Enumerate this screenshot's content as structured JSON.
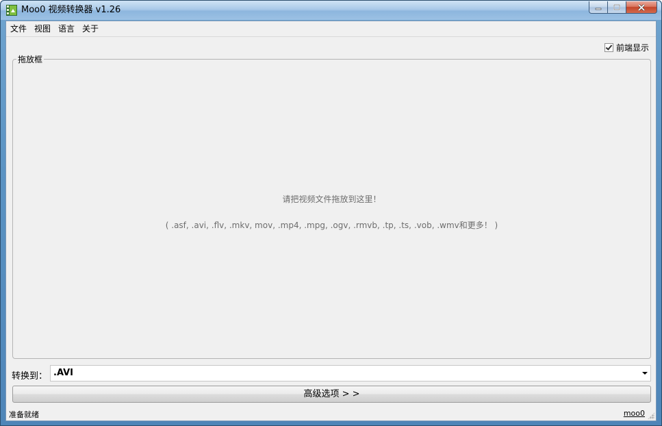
{
  "window": {
    "title": "Moo0 视频转换器 v1.26"
  },
  "menu": {
    "items": [
      "文件",
      "视图",
      "语言",
      "关于"
    ]
  },
  "options": {
    "always_on_top_label": "前端显示",
    "always_on_top_checked": true
  },
  "dropbox": {
    "legend": "拖放框",
    "prompt": "请把视频文件拖放到这里！",
    "formats": "( .asf, .avi, .flv, .mkv, mov, .mp4, .mpg, .ogv, .rmvb, .tp, .ts, .vob, .wmv和更多！ )"
  },
  "convert": {
    "label": "转换到：",
    "selected_format": ".AVI"
  },
  "advanced": {
    "label": "高级选项 > >"
  },
  "status": {
    "text": "准备就绪",
    "link": "moo0"
  },
  "icons": {
    "app": "film-icon",
    "minimize": "minimize-icon",
    "maximize": "maximize-icon",
    "close": "close-icon"
  }
}
